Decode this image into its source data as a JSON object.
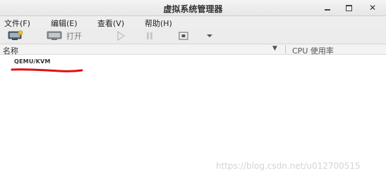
{
  "window": {
    "title": "虚拟系统管理器"
  },
  "menu": [
    "文件(F)",
    "编辑(E)",
    "查看(V)",
    "帮助(H)"
  ],
  "toolbar": {
    "open_label": "打开"
  },
  "list": {
    "columns": {
      "name": "名称",
      "cpu": "CPU 使用率"
    },
    "items": [
      {
        "label": "QEMU/KVM"
      }
    ]
  },
  "watermark": "https://blog.csdn.net/u012700515",
  "colors": {
    "annotation": "#e01010"
  }
}
